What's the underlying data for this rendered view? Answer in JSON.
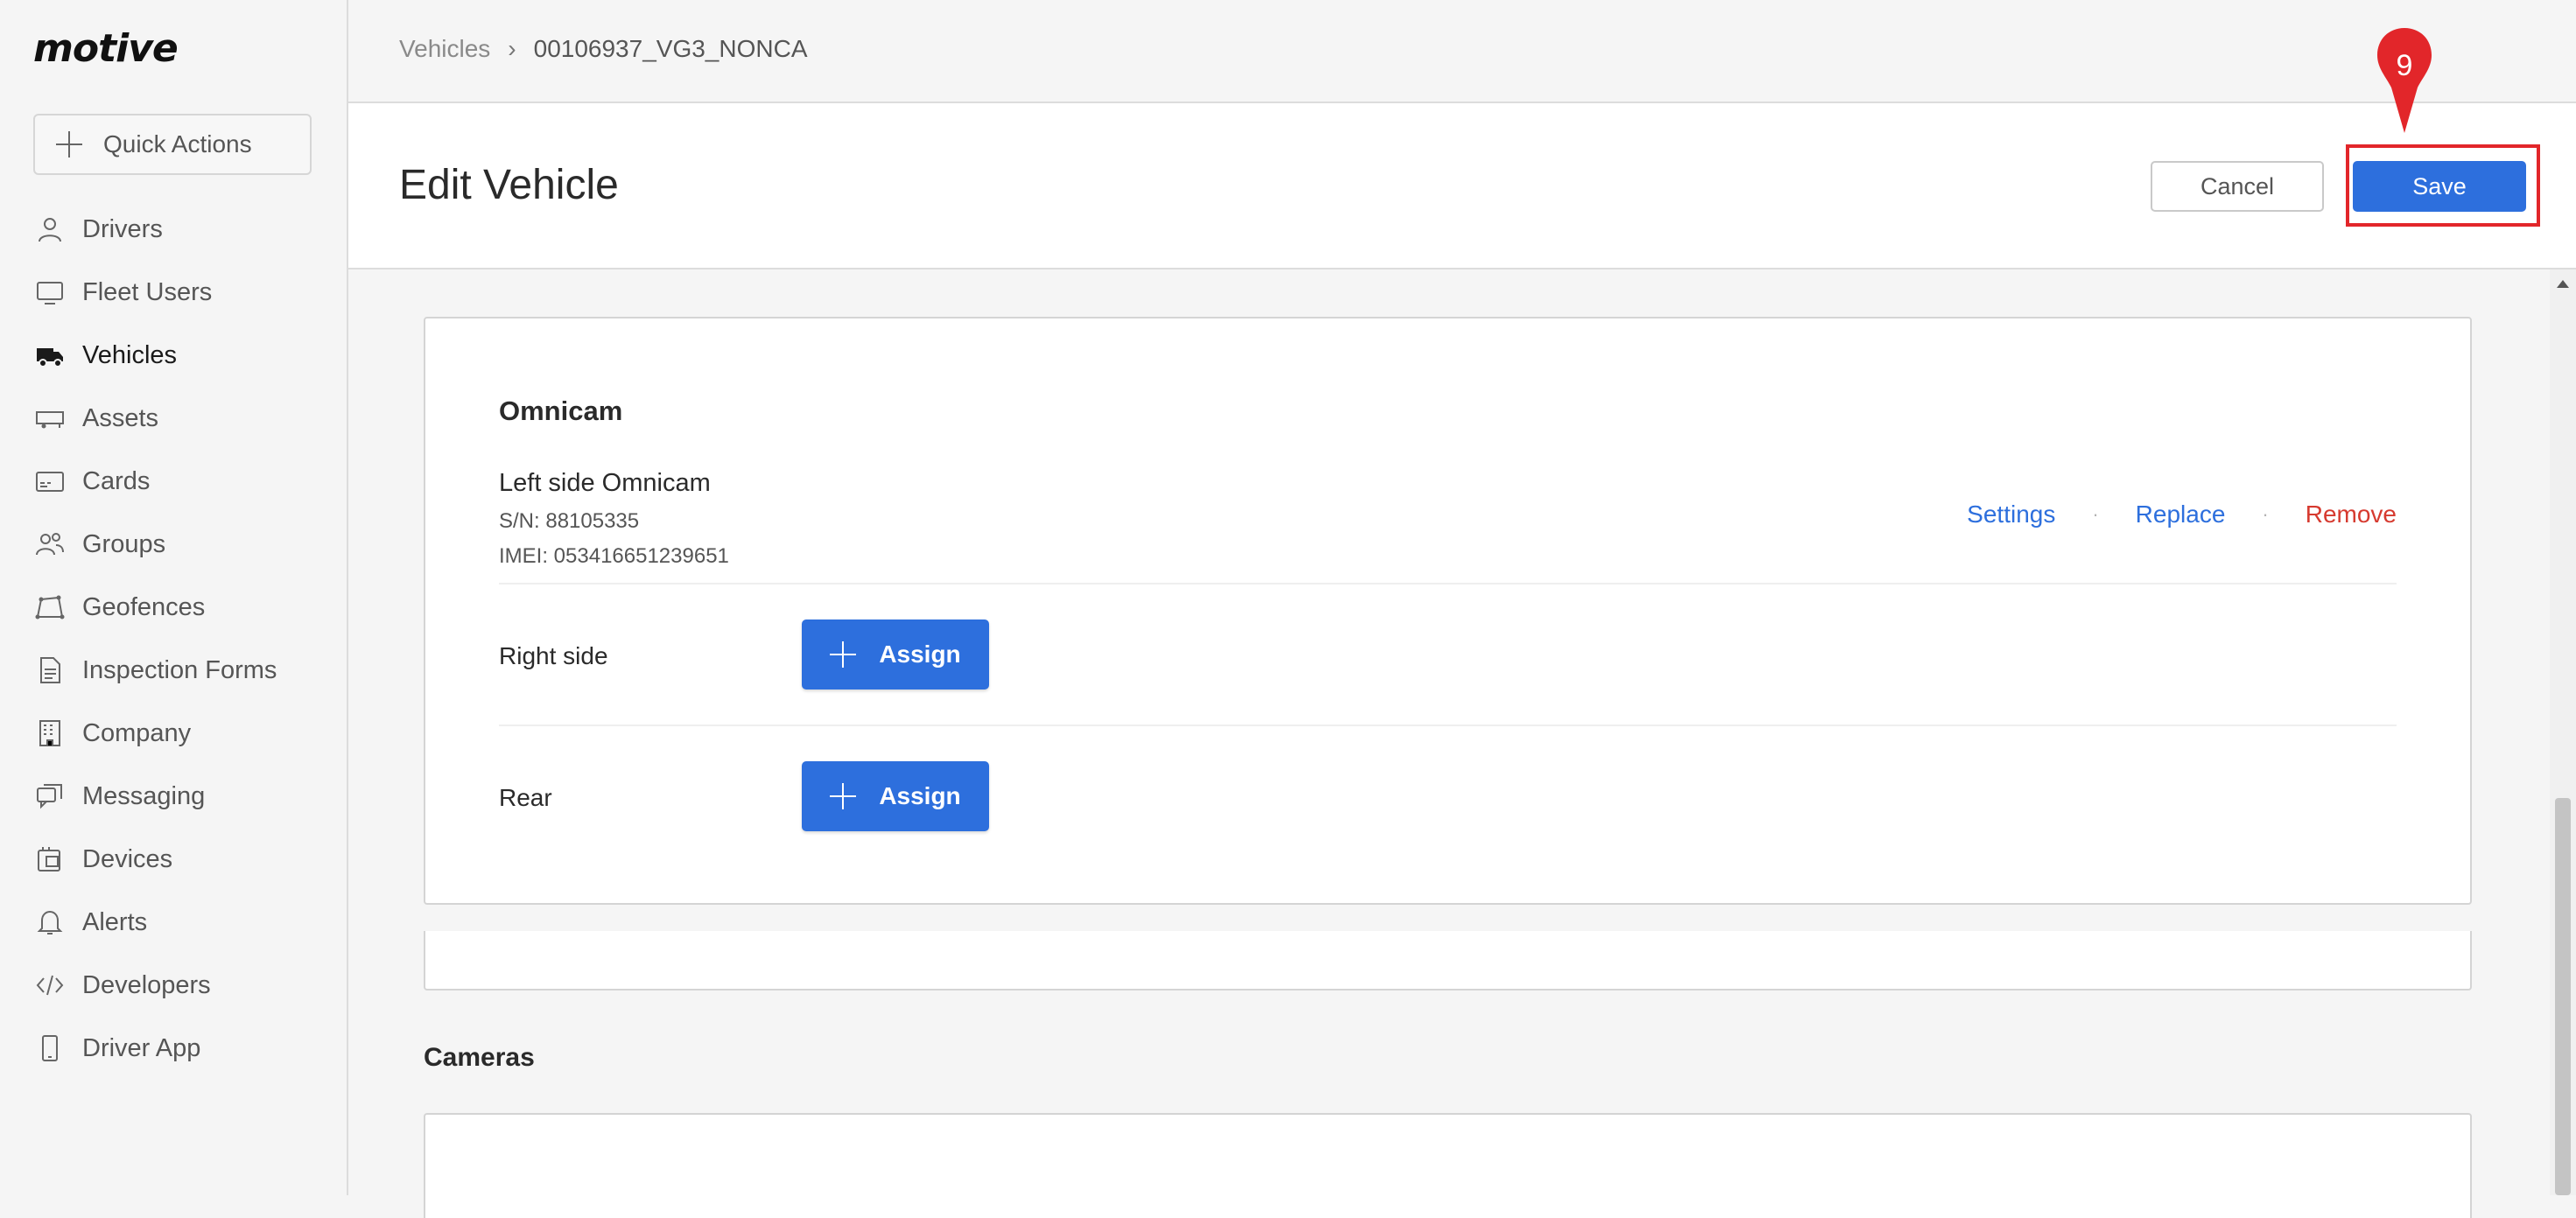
{
  "brand": {
    "logo_text": "motive"
  },
  "sidebar": {
    "quick_actions_label": "Quick Actions",
    "items": [
      {
        "label": "Drivers",
        "icon": "person-icon"
      },
      {
        "label": "Fleet Users",
        "icon": "monitor-icon"
      },
      {
        "label": "Vehicles",
        "icon": "truck-icon",
        "active": true
      },
      {
        "label": "Assets",
        "icon": "trailer-icon"
      },
      {
        "label": "Cards",
        "icon": "card-icon"
      },
      {
        "label": "Groups",
        "icon": "group-icon"
      },
      {
        "label": "Geofences",
        "icon": "geofence-icon"
      },
      {
        "label": "Inspection Forms",
        "icon": "document-icon"
      },
      {
        "label": "Company",
        "icon": "building-icon"
      },
      {
        "label": "Messaging",
        "icon": "chat-icon"
      },
      {
        "label": "Devices",
        "icon": "devices-icon"
      },
      {
        "label": "Alerts",
        "icon": "bell-icon"
      },
      {
        "label": "Developers",
        "icon": "code-icon"
      },
      {
        "label": "Driver App",
        "icon": "phone-icon"
      }
    ]
  },
  "breadcrumb": {
    "parent": "Vehicles",
    "separator": "›",
    "current": "00106937_VG3_NONCA"
  },
  "header": {
    "title": "Edit Vehicle",
    "cancel_label": "Cancel",
    "save_label": "Save"
  },
  "annotation": {
    "step_number": "9",
    "color": "#e2262a"
  },
  "omnicam_card": {
    "title": "Omnicam",
    "left": {
      "name": "Left side Omnicam",
      "serial": "S/N: 88105335",
      "imei": "IMEI: 053416651239651",
      "actions": {
        "settings": "Settings",
        "replace": "Replace",
        "remove": "Remove",
        "separator": "·"
      }
    },
    "rows": [
      {
        "label": "Right side",
        "button_label": "Assign"
      },
      {
        "label": "Rear",
        "button_label": "Assign"
      }
    ]
  },
  "cameras_section": {
    "title": "Cameras"
  },
  "colors": {
    "primary": "#2d6fdd",
    "danger": "#d63a2f",
    "background": "#f5f5f5"
  }
}
